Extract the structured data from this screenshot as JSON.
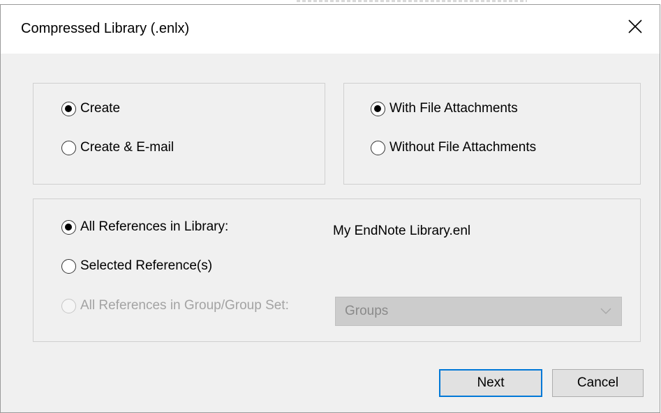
{
  "window": {
    "title": "Compressed Library (.enlx)",
    "close_icon": "close-icon"
  },
  "create_group": {
    "options": [
      {
        "label": "Create",
        "checked": true,
        "enabled": true
      },
      {
        "label": "Create & E-mail",
        "checked": false,
        "enabled": true
      }
    ]
  },
  "attachments_group": {
    "options": [
      {
        "label": "With File Attachments",
        "checked": true,
        "enabled": true
      },
      {
        "label": "Without File Attachments",
        "checked": false,
        "enabled": true
      }
    ]
  },
  "references_group": {
    "options": [
      {
        "label": "All References in Library:",
        "checked": true,
        "enabled": true
      },
      {
        "label": "Selected Reference(s)",
        "checked": false,
        "enabled": true
      },
      {
        "label": "All References in Group/Group Set:",
        "checked": false,
        "enabled": false
      }
    ],
    "library_name": "My EndNote Library.enl",
    "group_select": {
      "value": "Groups",
      "enabled": false,
      "icon": "chevron-down-icon"
    }
  },
  "buttons": {
    "next": "Next",
    "cancel": "Cancel"
  },
  "colors": {
    "dialog_bg": "#f0f0f0",
    "focus_border": "#0078d7",
    "disabled_text": "#a3a3a3"
  }
}
